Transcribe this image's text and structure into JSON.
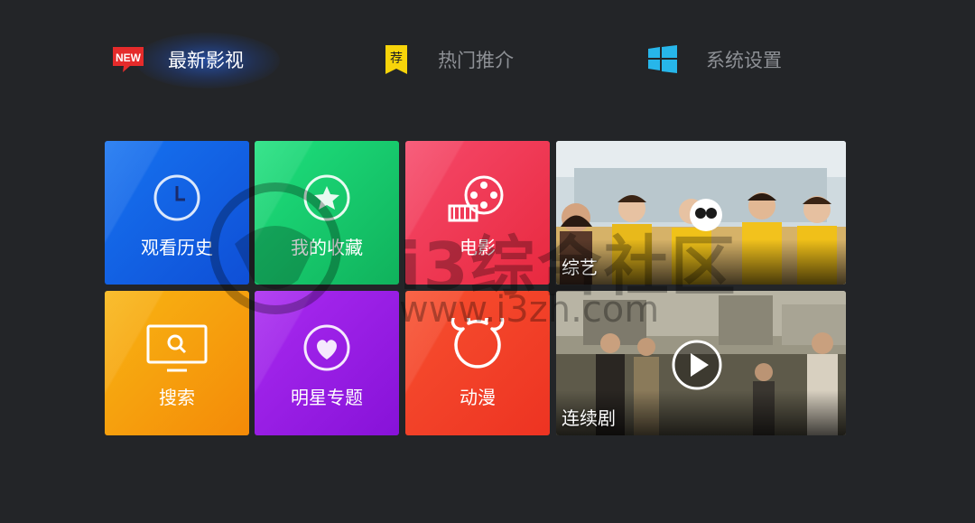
{
  "nav": {
    "latest": {
      "badge": "NEW",
      "label": "最新影视"
    },
    "hot": {
      "badge": "荐",
      "label": "热门推介"
    },
    "settings": {
      "label": "系统设置"
    }
  },
  "tiles": {
    "history": "观看历史",
    "favorites": "我的收藏",
    "movie": "电影",
    "variety": "综艺",
    "search": "搜索",
    "stars": "明星专题",
    "anime": "动漫",
    "series": "连续剧"
  },
  "watermark": {
    "text": "i3综合社区",
    "url": "www.i3zh.com"
  },
  "colors": {
    "background": "#232528",
    "accent_blue": "#1e6cff",
    "tile_history": "#1565e8",
    "tile_favorites": "#17c56a",
    "tile_movie": "#f03a57",
    "tile_search": "#f6a00a",
    "tile_stars": "#9b1ee6",
    "tile_anime": "#f2412c",
    "badge_new": "#e52b2b",
    "badge_hot": "#f7d40a",
    "windows_icon": "#27b6ea"
  },
  "icons": [
    "new-badge-icon",
    "recommend-badge-icon",
    "windows-icon",
    "clock-icon",
    "star-icon",
    "film-reel-icon",
    "monitor-search-icon",
    "heart-icon",
    "bear-icon",
    "play-icon"
  ]
}
